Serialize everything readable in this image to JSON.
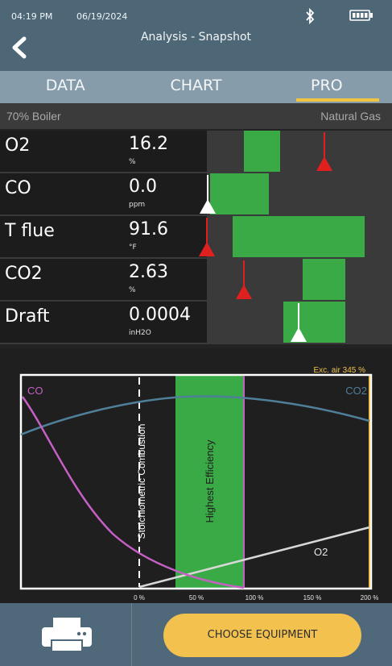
{
  "status": {
    "time": "04:19 PM",
    "date": "06/19/2024"
  },
  "header": {
    "title": "Analysis - Snapshot"
  },
  "icons": {
    "back": "back-chevron-icon",
    "bluetooth": "bluetooth-icon",
    "battery": "battery-icon",
    "printer": "printer-icon"
  },
  "tabs": [
    {
      "label": "DATA",
      "active": false
    },
    {
      "label": "CHART",
      "active": false
    },
    {
      "label": "PRO",
      "active": true
    }
  ],
  "subbar": {
    "left": "70% Boiler",
    "right": "Natural Gas"
  },
  "measurements": [
    {
      "name": "O2",
      "value": "16.2",
      "unit": "%"
    },
    {
      "name": "CO",
      "value": "0.0",
      "unit": "ppm"
    },
    {
      "name": "T flue",
      "value": "91.6",
      "unit": "°F"
    },
    {
      "name": "CO2",
      "value": "2.63",
      "unit": "%"
    },
    {
      "name": "Draft",
      "value": "0.0004",
      "unit": "inH2O"
    }
  ],
  "chart": {
    "exc_air_label": "Exc. air 345 %",
    "co_label": "CO",
    "co2_label": "CO2",
    "o2_label": "O2",
    "stoich_label": "Stoichiometric Combustion",
    "efficiency_label": "Highest Efficiency",
    "x_ticks": [
      "0 %",
      "50 %",
      "100 %",
      "150 %",
      "200 %"
    ]
  },
  "footer": {
    "choose_label": "CHOOSE EQUIPMENT"
  },
  "colors": {
    "header_bg": "#4e6777",
    "tab_bg": "#879caa",
    "accent_yellow": "#f2c14e",
    "zone_green": "#3aaa46",
    "marker_red": "#e0201f",
    "co_curve": "#c660c6",
    "co2_curve": "#4f7f99"
  }
}
